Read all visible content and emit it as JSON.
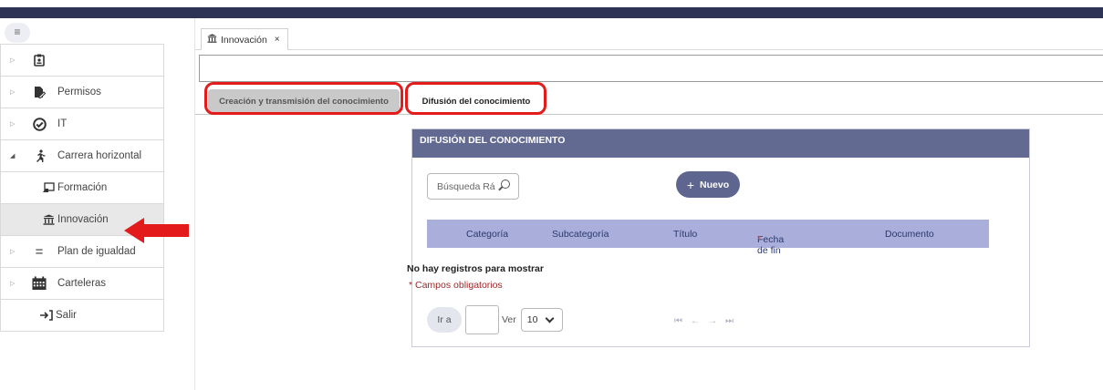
{
  "sidebar": {
    "toggle_icon": "hamburger-icon",
    "items": [
      {
        "label": "",
        "icon": "badge-icon"
      },
      {
        "label": "Permisos",
        "icon": "document-edit-icon"
      },
      {
        "label": "IT",
        "icon": "checkmark-circle-icon"
      },
      {
        "label": "Carrera horizontal",
        "icon": "runner-icon"
      },
      {
        "label": "Formación",
        "icon": "whiteboard-icon"
      },
      {
        "label": "Innovación",
        "icon": "institution-icon"
      },
      {
        "label": "Plan de igualdad",
        "icon": "equals-icon"
      },
      {
        "label": "Carteleras",
        "icon": "calendar-icon"
      },
      {
        "label": "Salir",
        "icon": "exit-icon"
      }
    ]
  },
  "tabs": {
    "open_tab": {
      "label": "Innovación",
      "close": "×"
    }
  },
  "subtabs": [
    {
      "label": "Creación y transmisión del conocimiento"
    },
    {
      "label": "Difusión del conocimiento"
    }
  ],
  "panel": {
    "title": "DIFUSIÓN DEL CONOCIMIENTO",
    "search_placeholder": "Búsqueda Rá",
    "new_button": "Nuevo",
    "columns": [
      "Categoría",
      "Subcategoría",
      "Título",
      "Fecha de fin",
      "Documento"
    ],
    "required_marker": "*",
    "empty_message": "No hay registros para mostrar",
    "required_note": "* Campos obligatorios",
    "pager": {
      "go_label": "Ir a",
      "view_label": "Ver",
      "page_size": "10"
    }
  },
  "colors": {
    "header_band": "#2d3354",
    "panel_header": "#636a92",
    "table_header": "#a9aedb",
    "annotation_red": "#e31b1b"
  }
}
